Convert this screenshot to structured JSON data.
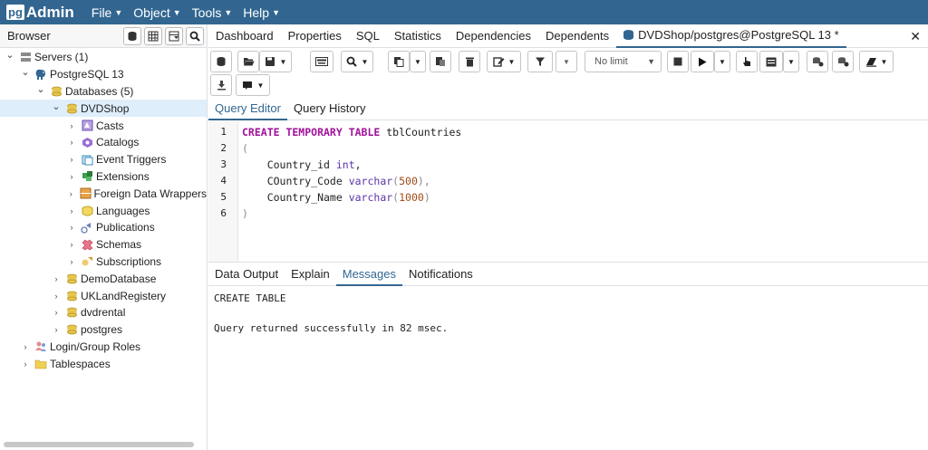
{
  "app": {
    "logo_pg": "pg",
    "logo_admin": "Admin"
  },
  "menu": [
    {
      "label": "File"
    },
    {
      "label": "Object"
    },
    {
      "label": "Tools"
    },
    {
      "label": "Help"
    }
  ],
  "browser": {
    "title": "Browser"
  },
  "tree": [
    {
      "label": "Servers (1)",
      "level": 0,
      "arrow": "⌄",
      "icon": "servers-icon"
    },
    {
      "label": "PostgreSQL 13",
      "level": 1,
      "arrow": "⌄",
      "icon": "elephant-icon"
    },
    {
      "label": "Databases (5)",
      "level": 2,
      "arrow": "⌄",
      "icon": "databases-icon"
    },
    {
      "label": "DVDShop",
      "level": 3,
      "arrow": "⌄",
      "icon": "database-icon",
      "selected": true
    },
    {
      "label": "Casts",
      "level": 4,
      "arrow": "›",
      "icon": "casts-icon"
    },
    {
      "label": "Catalogs",
      "level": 4,
      "arrow": "›",
      "icon": "catalogs-icon"
    },
    {
      "label": "Event Triggers",
      "level": 4,
      "arrow": "›",
      "icon": "event-triggers-icon"
    },
    {
      "label": "Extensions",
      "level": 4,
      "arrow": "›",
      "icon": "extensions-icon"
    },
    {
      "label": "Foreign Data Wrappers",
      "level": 4,
      "arrow": "›",
      "icon": "foreign-data-wrappers-icon"
    },
    {
      "label": "Languages",
      "level": 4,
      "arrow": "›",
      "icon": "languages-icon"
    },
    {
      "label": "Publications",
      "level": 4,
      "arrow": "›",
      "icon": "publications-icon"
    },
    {
      "label": "Schemas",
      "level": 4,
      "arrow": "›",
      "icon": "schemas-icon"
    },
    {
      "label": "Subscriptions",
      "level": 4,
      "arrow": "›",
      "icon": "subscriptions-icon"
    },
    {
      "label": "DemoDatabase",
      "level": 3,
      "arrow": "›",
      "icon": "database-icon"
    },
    {
      "label": "UKLandRegistery",
      "level": 3,
      "arrow": "›",
      "icon": "database-icon"
    },
    {
      "label": "dvdrental",
      "level": 3,
      "arrow": "›",
      "icon": "database-icon"
    },
    {
      "label": "postgres",
      "level": 3,
      "arrow": "›",
      "icon": "database-icon"
    },
    {
      "label": "Login/Group Roles",
      "level": 1,
      "arrow": "›",
      "icon": "login-roles-icon"
    },
    {
      "label": "Tablespaces",
      "level": 1,
      "arrow": "›",
      "icon": "tablespaces-icon"
    }
  ],
  "tabs": [
    {
      "label": "Dashboard"
    },
    {
      "label": "Properties"
    },
    {
      "label": "SQL"
    },
    {
      "label": "Statistics"
    },
    {
      "label": "Dependencies"
    },
    {
      "label": "Dependents"
    },
    {
      "label": "DVDShop/postgres@PostgreSQL 13 *"
    }
  ],
  "toolbar": {
    "limit_label": "No limit"
  },
  "editor_tabs": [
    {
      "label": "Query Editor"
    },
    {
      "label": "Query History"
    }
  ],
  "editor": {
    "lines": [
      {
        "num": "1",
        "parts": [
          {
            "t": "CREATE TEMPORARY TABLE",
            "c": "kw"
          },
          {
            "t": " tblCountries",
            "c": ""
          }
        ]
      },
      {
        "num": "2",
        "parts": [
          {
            "t": "(",
            "c": "pn"
          }
        ]
      },
      {
        "num": "3",
        "parts": [
          {
            "t": "    Country_id ",
            "c": ""
          },
          {
            "t": "int",
            "c": "ty"
          },
          {
            "t": ",",
            "c": ""
          }
        ]
      },
      {
        "num": "4",
        "parts": [
          {
            "t": "    COuntry_Code ",
            "c": ""
          },
          {
            "t": "varchar",
            "c": "ty"
          },
          {
            "t": "(",
            "c": "pn"
          },
          {
            "t": "500",
            "c": "nm"
          },
          {
            "t": "),",
            "c": "pn"
          }
        ]
      },
      {
        "num": "5",
        "parts": [
          {
            "t": "    Country_Name ",
            "c": ""
          },
          {
            "t": "varchar",
            "c": "ty"
          },
          {
            "t": "(",
            "c": "pn"
          },
          {
            "t": "1000",
            "c": "nm"
          },
          {
            "t": ")",
            "c": "pn"
          }
        ]
      },
      {
        "num": "6",
        "parts": [
          {
            "t": ")",
            "c": "pn"
          }
        ]
      }
    ]
  },
  "output_tabs": [
    {
      "label": "Data Output"
    },
    {
      "label": "Explain"
    },
    {
      "label": "Messages"
    },
    {
      "label": "Notifications"
    }
  ],
  "messages": {
    "line1": "CREATE TABLE",
    "line2": "Query returned successfully in 82 msec."
  },
  "colors": {
    "brand": "#326690",
    "selected": "#dfeefb",
    "keyword": "#a1119c"
  }
}
